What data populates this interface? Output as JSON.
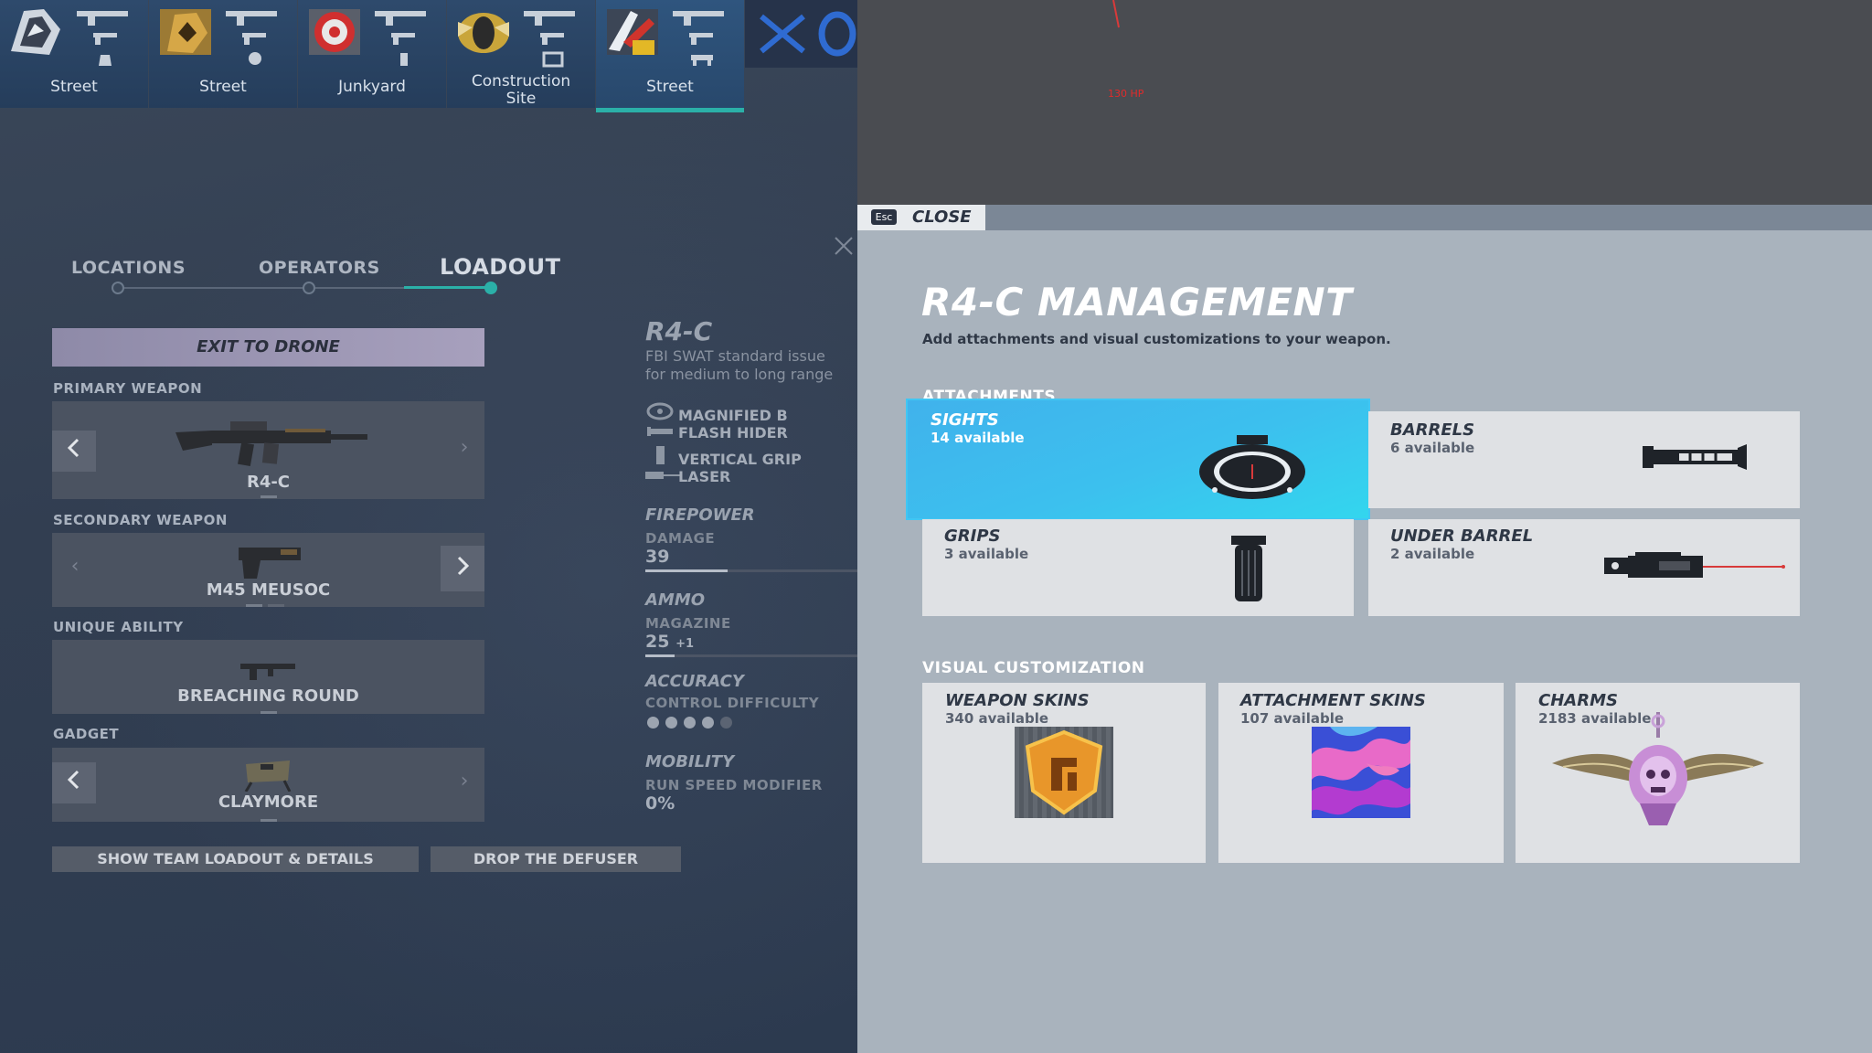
{
  "operators": [
    {
      "map": "Street",
      "icon": "operator-icon-1"
    },
    {
      "map": "Street",
      "icon": "operator-icon-2"
    },
    {
      "map": "Junkyard",
      "icon": "operator-icon-3"
    },
    {
      "map_line1": "Construction",
      "map_line2": "Site",
      "icon": "operator-icon-4"
    },
    {
      "map": "Street",
      "icon": "operator-icon-5",
      "active": true
    }
  ],
  "hud": {
    "hp": "130 HP"
  },
  "tabs": {
    "locations": "LOCATIONS",
    "operators": "OPERATORS",
    "loadout": "LOADOUT"
  },
  "loadout": {
    "exit_drone": "EXIT TO DRONE",
    "primary_label": "PRIMARY WEAPON",
    "primary_name": "R4-C",
    "secondary_label": "SECONDARY WEAPON",
    "secondary_name": "M45 MEUSOC",
    "ability_label": "UNIQUE ABILITY",
    "ability_name": "BREACHING ROUND",
    "gadget_label": "GADGET",
    "gadget_name": "CLAYMORE",
    "show_team": "SHOW TEAM LOADOUT & DETAILS",
    "drop_defuser": "DROP THE DEFUSER"
  },
  "weapon_details": {
    "name": "R4-C",
    "desc_line1": "FBI SWAT standard issue",
    "desc_line2": "for medium to long range",
    "attachments": [
      "MAGNIFIED B",
      "FLASH HIDER",
      "VERTICAL GRIP",
      "LASER"
    ],
    "firepower": {
      "header": "FIREPOWER",
      "label": "DAMAGE",
      "value": "39",
      "fill": 0.39
    },
    "ammo": {
      "header": "AMMO",
      "label": "MAGAZINE",
      "value": "25",
      "extra": "+1",
      "fill": 0.14
    },
    "accuracy": {
      "header": "ACCURACY",
      "label": "CONTROL DIFFICULTY",
      "level": 4,
      "max": 5
    },
    "mobility": {
      "header": "MOBILITY",
      "label": "RUN SPEED MODIFIER",
      "value": "0%"
    }
  },
  "management": {
    "esc": "Esc",
    "close": "CLOSE",
    "title": "R4-C MANAGEMENT",
    "subtitle": "Add attachments and visual customizations to your weapon.",
    "attachments_label": "ATTACHMENTS",
    "attachments": [
      {
        "title": "SIGHTS",
        "sub": "14 available",
        "icon": "sight-icon",
        "selected": true
      },
      {
        "title": "BARRELS",
        "sub": "6 available",
        "icon": "barrel-icon"
      },
      {
        "title": "GRIPS",
        "sub": "3 available",
        "icon": "grip-icon"
      },
      {
        "title": "UNDER BARREL",
        "sub": "2 available",
        "icon": "laser-icon"
      }
    ],
    "visual_label": "VISUAL CUSTOMIZATION",
    "visual": [
      {
        "title": "WEAPON SKINS",
        "sub": "340 available",
        "icon": "skin-badge-icon"
      },
      {
        "title": "ATTACHMENT SKINS",
        "sub": "107 available",
        "icon": "camo-swatch-icon"
      },
      {
        "title": "CHARMS",
        "sub": "2183 available",
        "icon": "winged-skull-charm-icon"
      }
    ]
  },
  "colors": {
    "accent_teal": "#2bb0a8",
    "sights_blue": "#3cc0ee",
    "hp_red": "#e02b2b"
  }
}
